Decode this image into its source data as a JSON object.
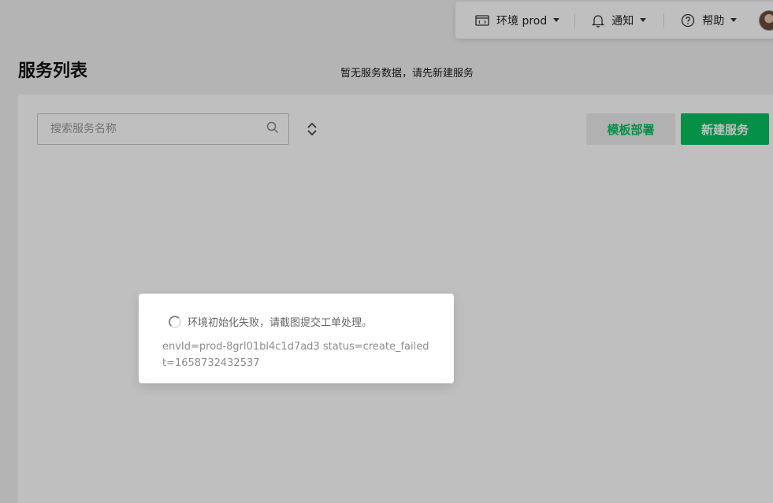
{
  "header": {
    "env_label": "环境 prod",
    "notice_label": "通知",
    "help_label": "帮助"
  },
  "page": {
    "title": "服务列表"
  },
  "toolbar": {
    "search_placeholder": "搜索服务名称",
    "template_button": "模板部署",
    "new_button": "新建服务"
  },
  "empty": {
    "message": "暂无服务数据，请先新建服务"
  },
  "toast": {
    "message": "环境初始化失败，请截图提交工单处理。",
    "detail": "envId=prod-8grl01bl4c1d7ad3 status=create_failed t=1658732432537"
  },
  "colors": {
    "accent": "#07c160",
    "overlay": "rgba(0,0,0,0.25)"
  }
}
